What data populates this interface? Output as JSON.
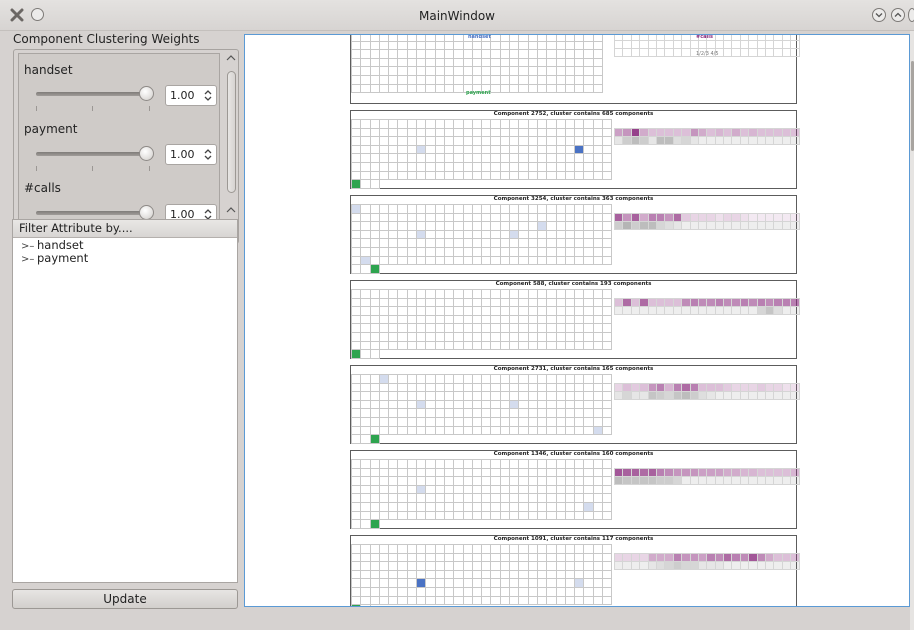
{
  "window": {
    "title": "MainWindow"
  },
  "weights": {
    "label": "Component Clustering Weights",
    "items": [
      {
        "name": "handset",
        "value": "1.00"
      },
      {
        "name": "payment",
        "value": "1.00"
      },
      {
        "name": "#calls",
        "value": "1.00"
      }
    ]
  },
  "filter": {
    "header": "Filter Attribute by....",
    "items": [
      {
        "label": "handset"
      },
      {
        "label": "payment"
      }
    ]
  },
  "update_label": "Update",
  "header_component": {
    "top_label": "handset",
    "bottom_label": "payment",
    "calls_label": "#calls",
    "calls_sublabel": "1/2/3 4/5"
  },
  "components": [
    {
      "title": "Component 2752, cluster contains 685 components"
    },
    {
      "title": "Component 3254, cluster contains 363 components"
    },
    {
      "title": "Component 588, cluster contains 193 components"
    },
    {
      "title": "Component 2731, cluster contains 165 components"
    },
    {
      "title": "Component 1346, cluster contains 160 components"
    },
    {
      "title": "Component 1091, cluster contains 117 components"
    }
  ],
  "colors": {
    "accent_blue": "#4a72c4",
    "accent_green": "#2ea44f",
    "magenta_dark": "#8b2c7e",
    "canvas_border": "#5b9ad5"
  }
}
